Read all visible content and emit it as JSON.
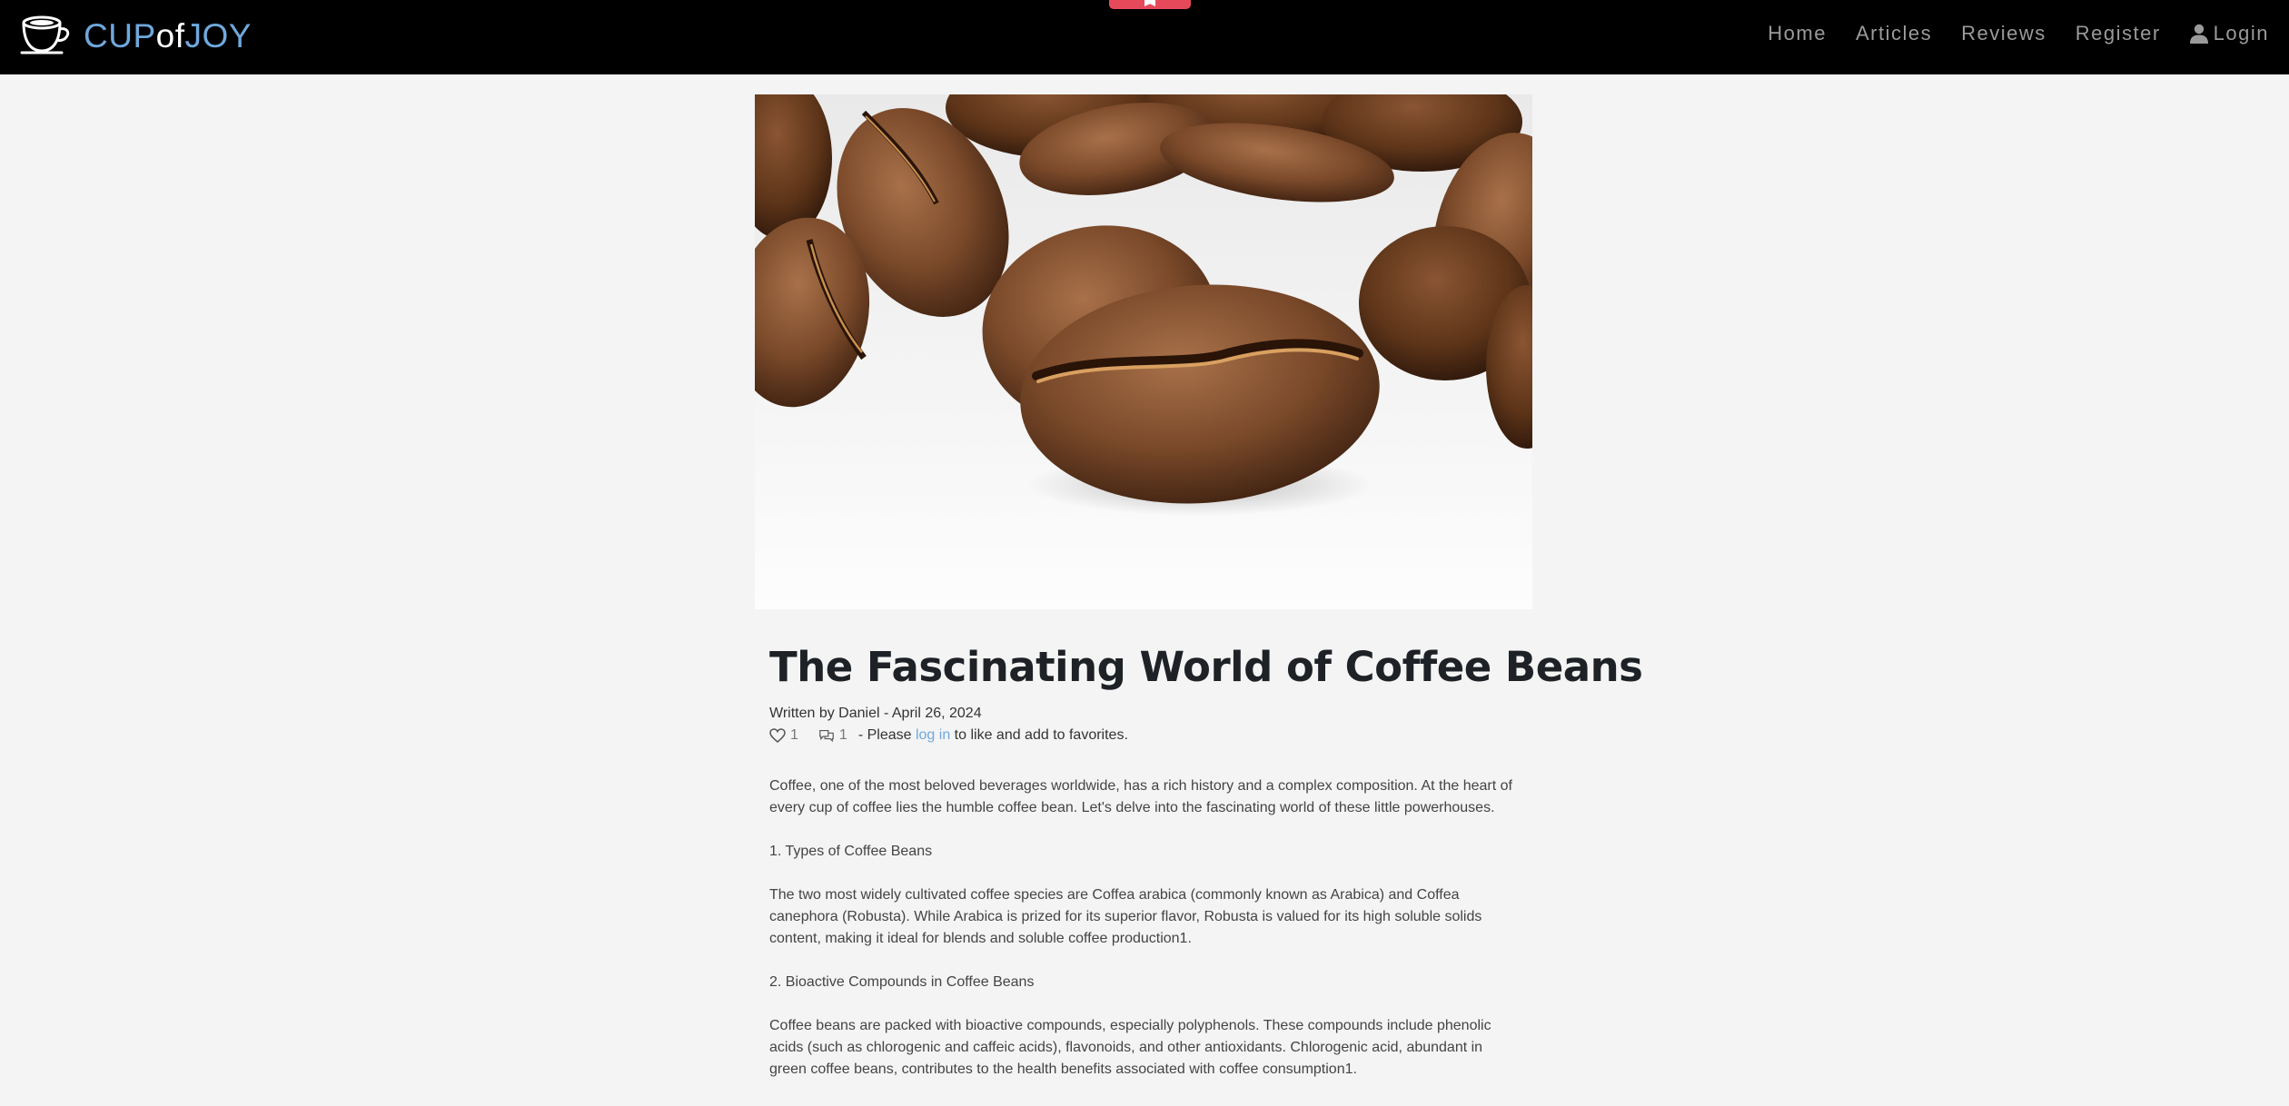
{
  "brand": {
    "part1": "CUP",
    "part2": "of",
    "part3": "JOY",
    "accent_color": "#6fa8dc",
    "icon": "coffee-cup-icon"
  },
  "top_tab": {
    "color": "#e64a5a"
  },
  "nav": {
    "home": "Home",
    "articles": "Articles",
    "reviews": "Reviews",
    "register": "Register",
    "login": "Login"
  },
  "hero": {
    "alt": "Close-up of roasted coffee beans"
  },
  "article": {
    "title": "The Fascinating World of Coffee Beans",
    "meta": "Written by Daniel - April 26, 2024",
    "likes": "1",
    "comments": "1",
    "prompt_before": "- Please",
    "prompt_link": "log in",
    "prompt_after": "to like and add to favorites.",
    "paragraphs": [
      "Coffee, one of the most beloved beverages worldwide, has a rich history and a complex composition. At the heart of every cup of coffee lies the humble coffee bean. Let's delve into the fascinating world of these little powerhouses.",
      "1. Types of Coffee Beans",
      "The two most widely cultivated coffee species are Coffea arabica (commonly known as Arabica) and Coffea canephora (Robusta). While Arabica is prized for its superior flavor, Robusta is valued for its high soluble solids content, making it ideal for blends and soluble coffee production1.",
      "2. Bioactive Compounds in Coffee Beans",
      "Coffee beans are packed with bioactive compounds, especially polyphenols. These compounds include phenolic acids (such as chlorogenic and caffeic acids), flavonoids, and other antioxidants. Chlorogenic acid, abundant in green coffee beans, contributes to the health benefits associated with coffee consumption1."
    ]
  }
}
